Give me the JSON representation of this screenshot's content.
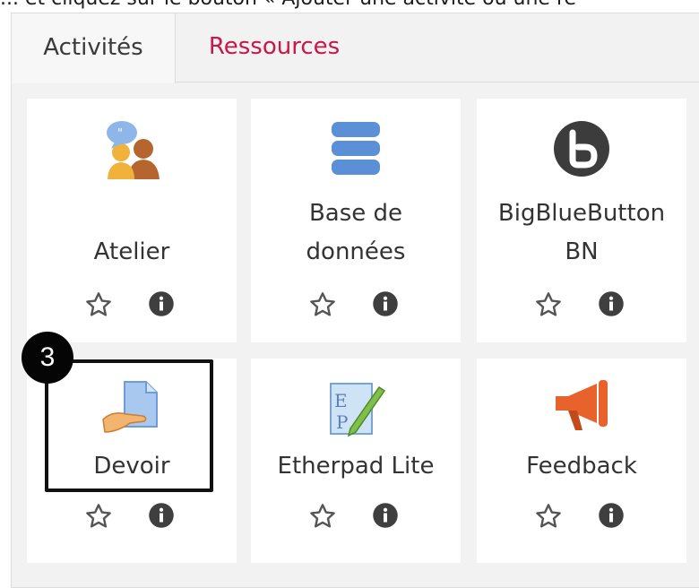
{
  "instruction": "... et cliquez sur le bouton « Ajouter une activité ou une re",
  "tabs": [
    {
      "label": "Activités",
      "active": true
    },
    {
      "label": "Ressources",
      "active": false
    }
  ],
  "cards": [
    {
      "label_lines": [
        "Atelier"
      ],
      "icon": "workshop-icon"
    },
    {
      "label_lines": [
        "Base de",
        "données"
      ],
      "icon": "database-icon"
    },
    {
      "label_lines": [
        "BigBlueButton",
        "BN"
      ],
      "icon": "bigbluebutton-icon"
    },
    {
      "label_lines": [
        "Devoir"
      ],
      "icon": "assignment-icon"
    },
    {
      "label_lines": [
        "Etherpad Lite"
      ],
      "icon": "etherpad-icon"
    },
    {
      "label_lines": [
        "Feedback"
      ],
      "icon": "feedback-icon"
    }
  ],
  "step_badge": "3",
  "colors": {
    "tab_inactive": "#c8174a",
    "panel_bg": "#f2f2f2",
    "card_bg": "#ffffff",
    "icon_dark": "#444444"
  }
}
